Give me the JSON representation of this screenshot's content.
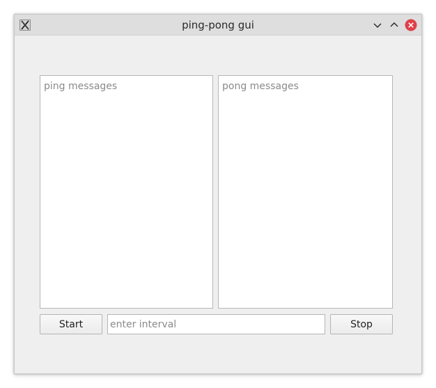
{
  "window": {
    "title": "ping-pong gui",
    "app_icon": "x-app-icon",
    "controls": {
      "minimize_icon": "chevron-down-icon",
      "maximize_icon": "chevron-up-icon",
      "close_icon": "close-icon",
      "close_color": "#e0404a"
    }
  },
  "ping_pane": {
    "placeholder": "ping messages",
    "value": ""
  },
  "pong_pane": {
    "placeholder": "pong messages",
    "value": ""
  },
  "controls": {
    "start_label": "Start",
    "interval_placeholder": "enter interval",
    "interval_value": "",
    "stop_label": "Stop"
  }
}
